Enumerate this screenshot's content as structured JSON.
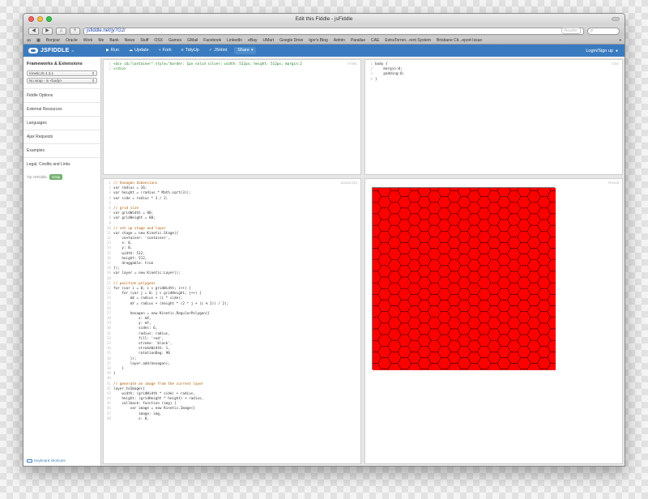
{
  "browser": {
    "window_title": "Edit this Fiddle - jsFiddle",
    "url": "jsfiddle.net/jy7G2/",
    "reader_label": "Reader",
    "bookmarks": [
      "Bonjour",
      "Oracle",
      "Work",
      "Me",
      "Bank",
      "News",
      "Stuff",
      "OSX",
      "Games",
      "GMail",
      "Facebook",
      "LinkedIn",
      "eBay",
      "UMart",
      "Google Drive",
      "Igor's Blog",
      "Admin",
      "Parallax",
      "CAE",
      "ExtraTorren...rent System",
      "Brisbane Cit...eport Issue"
    ],
    "bookmarks_overflow": "»"
  },
  "header": {
    "logo": "JSFIDDLE",
    "logo_suffix": "α",
    "buttons": [
      {
        "label": "Run",
        "icon": "play-icon",
        "glyph": "▶"
      },
      {
        "label": "Update",
        "icon": "cloud-upload-icon",
        "glyph": "☁"
      },
      {
        "label": "Fork",
        "icon": "fork-icon",
        "glyph": "⑂"
      },
      {
        "label": "TidyUp",
        "icon": "tidy-icon",
        "glyph": "≡"
      },
      {
        "label": "JSHint",
        "icon": "check-icon",
        "glyph": "✓"
      }
    ],
    "share_label": "Share",
    "share_glyph": "▾",
    "login_label": "Login/Sign up",
    "user_glyph": "👤"
  },
  "sidebar": {
    "heading": "Frameworks & Extensions",
    "framework_select": "KineticJS 4.3.1",
    "wrap_select": "No wrap - in <body>",
    "items": [
      "Fiddle Options",
      "External Resources",
      "Languages",
      "Ajax Requests",
      "Examples",
      "Legal, Credits and Links"
    ],
    "tip_label": "Tip JSFiddle",
    "gittip_label": "Gittip",
    "keyboard_label": "Keyboard shortcuts"
  },
  "panes": {
    "html_label": "HTML",
    "css_label": "CSS",
    "js_label": "JavaScript",
    "result_label": "Result",
    "result_fill": "#ff0000"
  },
  "html_code": [
    "<div id=\"container\" style=\"border: 1px solid silver; width: 512px; height: 512px; margin:2",
    "</div>"
  ],
  "css_code": [
    "body {",
    "    margin:0;",
    "    padding:0;",
    "}"
  ],
  "js_code": [
    "// hexagon dimensions",
    "var radius = 16;",
    "var height = (radius * Math.sqrt(3));",
    "var side = radius * 3 / 2;",
    "",
    "// grid size",
    "var gridWidth = 80;",
    "var gridHeight = 80;",
    "",
    "// set up stage and layer",
    "var stage = new Kinetic.Stage({",
    "    container: 'container',",
    "    x: 0,",
    "    y: 0,",
    "    width: 512,",
    "    height: 512,",
    "    draggable: true",
    "});",
    "var layer = new Kinetic.Layer();",
    "",
    "// position polygons",
    "for (var i = 0; i < gridWidth; i++) {",
    "    for (var j = 0; j < gridHeight; j++) {",
    "        mX = radius + (i * side);",
    "        mY = radius + (height * (2 * j + (i % 2)) / 2);",
    "",
    "        hexagon = new Kinetic.RegularPolygon({",
    "            x: mX,",
    "            y: mY,",
    "            sides: 6,",
    "            radius: radius,",
    "            fill: 'red',",
    "            stroke: 'black',",
    "            strokeWidth: 1,",
    "            rotationDeg: 90",
    "        });",
    "        layer.add(hexagon);",
    "    }",
    "}",
    "",
    "// generate an image from the current layer",
    "layer.toImage({",
    "    width: (gridWidth * side) + radius,",
    "    height: (gridHeight * height) + radius,",
    "    callback: function (img) {",
    "        var image = new Kinetic.Image({",
    "            image: img,",
    "            x: 0,"
  ]
}
